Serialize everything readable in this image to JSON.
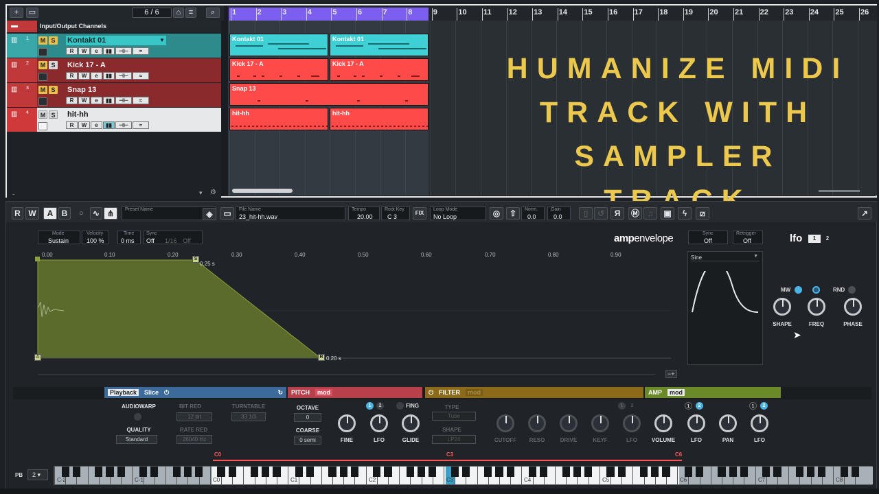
{
  "project": {
    "track_count": "6 / 6",
    "folder_label": "Input/Output Channels",
    "bars": [
      "1",
      "2",
      "3",
      "4",
      "5",
      "6",
      "7",
      "8",
      "9",
      "10",
      "11",
      "12",
      "13",
      "14",
      "15",
      "16",
      "17",
      "18",
      "19",
      "20",
      "21",
      "22",
      "23",
      "24",
      "25",
      "26"
    ],
    "tracks": [
      {
        "num": "1",
        "name": "Kontakt 01",
        "color": "#3aa8a8",
        "part_color": "#3ed0d4",
        "parts": [
          "Kontakt 01",
          "Kontakt 01"
        ]
      },
      {
        "num": "2",
        "name": "Kick 17 - A",
        "color": "#c0393a",
        "part_color": "#ff4a4a",
        "parts": [
          "Kick 17 - A",
          "Kick 17 - A"
        ]
      },
      {
        "num": "3",
        "name": "Snap 13",
        "color": "#c0393a",
        "part_color": "#ff4a4a",
        "parts": [
          "Snap 13"
        ]
      },
      {
        "num": "4",
        "name": "hit-hh",
        "color": "#c0393a",
        "part_color": "#ff4a4a",
        "parts": [
          "hit-hh",
          "hit-hh"
        ]
      }
    ],
    "track_buttons": {
      "mute": "M",
      "solo": "S",
      "read": "R",
      "write": "W",
      "edit": "e"
    }
  },
  "overlay_title": [
    "HUMANIZE MIDI",
    "TRACK WITH",
    "SAMPLER TRACK"
  ],
  "sampler": {
    "toolbar": {
      "r": "R",
      "w": "W",
      "a": "A",
      "b": "B",
      "preset_label": "Preset Name",
      "file_label": "File Name",
      "file_value": "23_hit-hh.wav",
      "tempo_label": "Tempo",
      "tempo_value": "20.00",
      "root_label": "Root Key",
      "root_value": "C 3",
      "fix": "FIX",
      "loop_label": "Loop Mode",
      "loop_value": "No Loop",
      "norm_label": "Norm.",
      "norm_value": "0.0",
      "gain_label": "Gain",
      "gain_value": "0.0"
    },
    "env": {
      "mode_label": "Mode",
      "mode_value": "Sustain",
      "velocity_label": "Velocity",
      "velocity_value": "100 %",
      "time_label": "Time",
      "time_value": "0 ms",
      "sync_label": "Sync",
      "sync_value": "Off",
      "sync_rate": "1/16",
      "sync_off": "Off",
      "title_bold": "amp",
      "title_rest": "envelope",
      "ticks": [
        "0.00",
        "0.10",
        "0.20",
        "0.30",
        "0.40",
        "0.50",
        "0.60",
        "0.70",
        "0.80",
        "0.90"
      ],
      "sustain_time": "0.25 s",
      "release_time": "0.20 s",
      "node_s": "S",
      "node_r": "R",
      "zoom": "−+"
    },
    "lfo": {
      "sync_label": "Sync",
      "sync_value": "Off",
      "retrigger_label": "Retrigger",
      "retrigger_value": "Off",
      "title": "lfo",
      "tab1": "1",
      "tab2": "2",
      "waveform": "Sine",
      "mw": "MW",
      "rnd": "RND",
      "knobs": [
        "SHAPE",
        "FREQ",
        "PHASE"
      ]
    },
    "playback": {
      "tab_playback": "Playback",
      "tab_slice": "Slice",
      "audiowarp": "AUDIOWARP",
      "bit_red_label": "BIT RED",
      "bit_red_value": "12 bit",
      "turntable_label": "TURNTABLE",
      "turntable_value": "33 1/3",
      "quality_label": "QUALITY",
      "quality_value": "Standard",
      "rate_red_label": "RATE RED",
      "rate_red_value": "26040 Hz"
    },
    "pitch": {
      "title": "PITCH",
      "mod": "mod",
      "octave_label": "OCTAVE",
      "octave_value": "0",
      "coarse_label": "COARSE",
      "coarse_value": "0 semi",
      "knobs": [
        "FINE",
        "LFO",
        "GLIDE"
      ],
      "fing": "FING",
      "lfo1": "1",
      "lfo2": "2"
    },
    "filter": {
      "title": "FILTER",
      "mod": "mod",
      "type_label": "TYPE",
      "type_value": "Tube",
      "shape_label": "SHAPE",
      "shape_value": "LP24",
      "knobs": [
        "CUTOFF",
        "RESO",
        "DRIVE",
        "KEYF",
        "LFO"
      ],
      "lfo1": "1",
      "lfo2": "2"
    },
    "amp": {
      "title": "AMP",
      "mod": "mod",
      "knobs": [
        "VOLUME",
        "LFO",
        "PAN",
        "LFO"
      ],
      "lfo1": "1",
      "lfo2": "2"
    },
    "keyboard": {
      "pb_label": "PB",
      "pb_value": "2",
      "markers": [
        "C0",
        "C3",
        "C6"
      ],
      "octaves": [
        "C-2",
        "C-1",
        "C0",
        "C1",
        "C2",
        "C3",
        "C4",
        "C5",
        "C6",
        "C7",
        "C8"
      ]
    }
  },
  "colors": {
    "accent_cyan": "#3ed0d4",
    "track_red": "#ff4a4a",
    "loop_purple": "#7d5ff0",
    "env_fill": "#5b6b2b",
    "title_yellow": "#ecc94d",
    "playback_blue": "#3c6a9a",
    "pitch_red": "#b8404a",
    "filter_orange": "#8c6a1a",
    "amp_green": "#6a8a2a"
  }
}
